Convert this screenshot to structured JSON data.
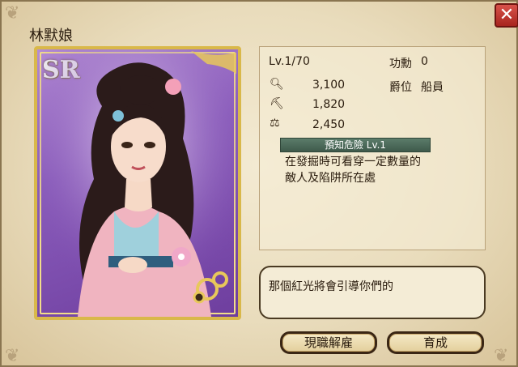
{
  "character": {
    "name": "林默娘",
    "rarity": "SR"
  },
  "stats": {
    "level": "Lv.1/70",
    "merit_label": "功勳",
    "merit_value": "0",
    "attack_value": "3,100",
    "defense_value": "1,820",
    "speed_value": "2,450",
    "rank_label": "爵位",
    "rank_value": "船員"
  },
  "skill": {
    "name": "預知危險 Lv.1",
    "description_line1": "在發掘時可看穿一定數量的",
    "description_line2": "敵人及陷阱所在處"
  },
  "dialog": {
    "text": "那個紅光將會引導你們的"
  },
  "buttons": {
    "dismiss": "現職解雇",
    "train": "育成",
    "close": "✕"
  },
  "icons": {
    "attack": "magnifier-icon",
    "defense": "pickaxe-icon",
    "speed": "balance-icon"
  },
  "colors": {
    "card_border": "#d9b84a",
    "skill_bar": "#4d6b5a",
    "close_button": "#c0392b"
  }
}
